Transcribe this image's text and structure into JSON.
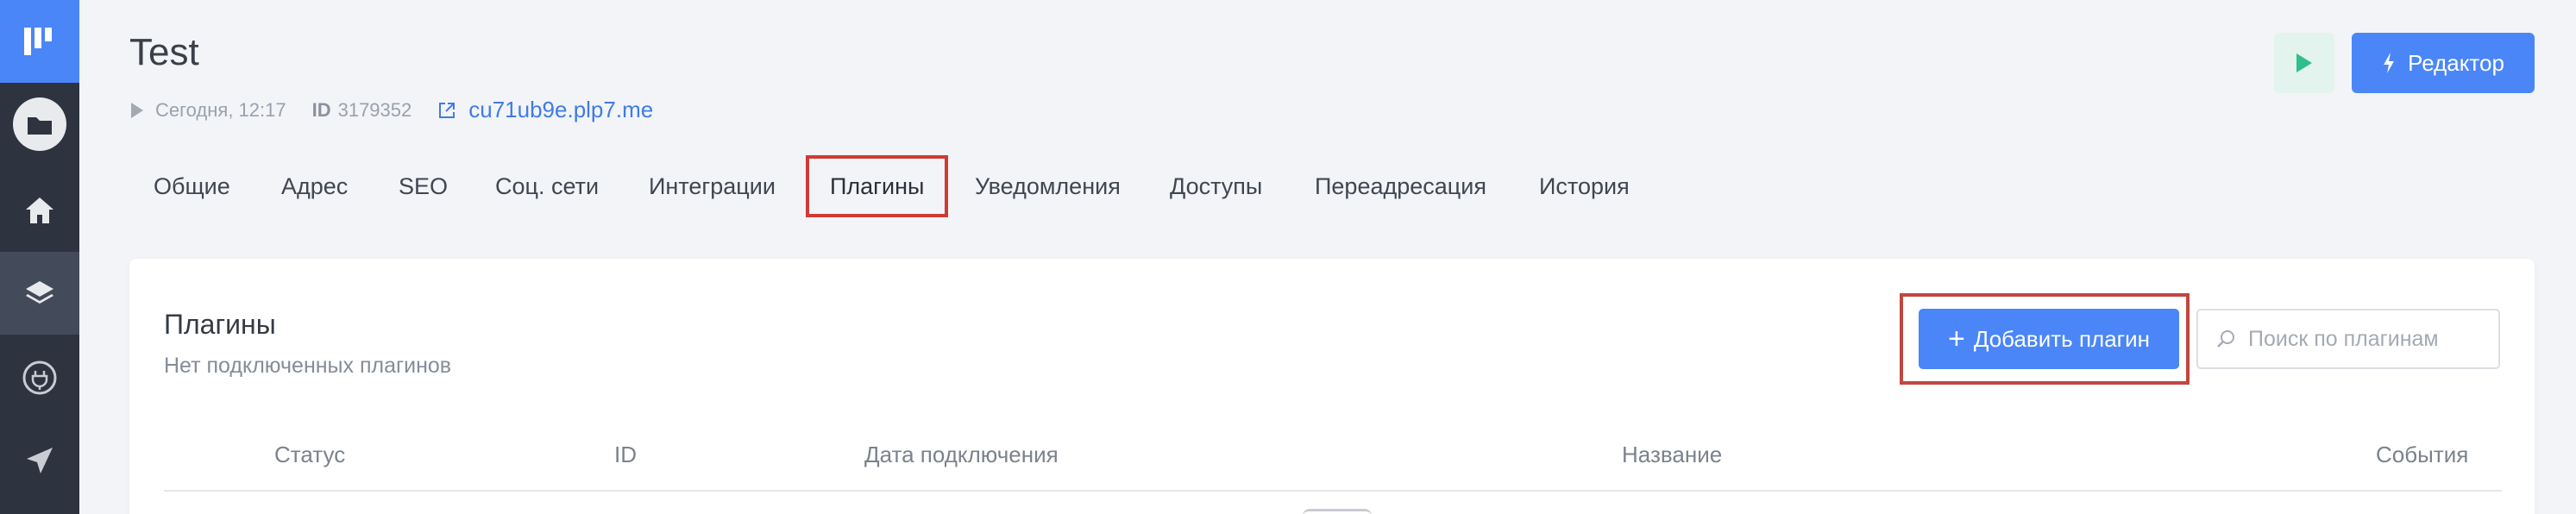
{
  "header": {
    "title": "Test",
    "meta": {
      "date": "Сегодня, 12:17",
      "id_label": "ID",
      "id_value": "3179352",
      "link": "cu71ub9e.plp7.me"
    },
    "editor_button": "Редактор"
  },
  "tabs": [
    {
      "label": "Общие"
    },
    {
      "label": "Адрес"
    },
    {
      "label": "SEO"
    },
    {
      "label": "Соц. сети"
    },
    {
      "label": "Интеграции"
    },
    {
      "label": "Плагины",
      "active": true
    },
    {
      "label": "Уведомления"
    },
    {
      "label": "Доступы"
    },
    {
      "label": "Переадресация"
    },
    {
      "label": "История"
    }
  ],
  "card": {
    "title": "Плагины",
    "subtitle": "Нет подключенных плагинов",
    "add_button": "Добавить плагин",
    "search_placeholder": "Поиск по плагинам",
    "columns": [
      "Статус",
      "ID",
      "Дата подключения",
      "Название",
      "События"
    ]
  },
  "sidebar": {
    "icons": [
      "logo-icon",
      "folder-icon",
      "home-icon",
      "layers-icon",
      "plug-icon",
      "send-icon"
    ]
  },
  "colors": {
    "accent": "#4a86f7",
    "sidebar": "#2e3340",
    "highlight": "#cf3a35"
  }
}
